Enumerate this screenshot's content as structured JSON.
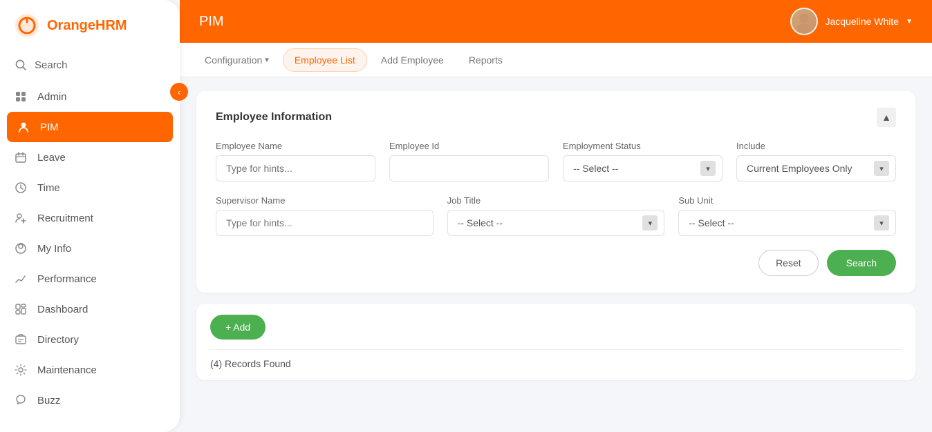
{
  "app": {
    "name": "OrangeHRM"
  },
  "header": {
    "title": "PIM",
    "user": {
      "name": "Jacqueline White",
      "chevron": "▼"
    }
  },
  "sidebar": {
    "toggle_icon": "‹",
    "search_label": "Search",
    "items": [
      {
        "id": "admin",
        "label": "Admin",
        "icon": "admin"
      },
      {
        "id": "pim",
        "label": "PIM",
        "icon": "pim",
        "active": true
      },
      {
        "id": "leave",
        "label": "Leave",
        "icon": "leave"
      },
      {
        "id": "time",
        "label": "Time",
        "icon": "time"
      },
      {
        "id": "recruitment",
        "label": "Recruitment",
        "icon": "recruitment"
      },
      {
        "id": "my-info",
        "label": "My Info",
        "icon": "my-info"
      },
      {
        "id": "performance",
        "label": "Performance",
        "icon": "performance"
      },
      {
        "id": "dashboard",
        "label": "Dashboard",
        "icon": "dashboard"
      },
      {
        "id": "directory",
        "label": "Directory",
        "icon": "directory"
      },
      {
        "id": "maintenance",
        "label": "Maintenance",
        "icon": "maintenance"
      },
      {
        "id": "buzz",
        "label": "Buzz",
        "icon": "buzz"
      }
    ]
  },
  "nav_tabs": [
    {
      "id": "configuration",
      "label": "Configuration",
      "has_dropdown": true,
      "active": false
    },
    {
      "id": "employee-list",
      "label": "Employee List",
      "has_dropdown": false,
      "active": true
    },
    {
      "id": "add-employee",
      "label": "Add Employee",
      "has_dropdown": false,
      "active": false
    },
    {
      "id": "reports",
      "label": "Reports",
      "has_dropdown": false,
      "active": false
    }
  ],
  "employee_info": {
    "section_title": "Employee Information",
    "fields": {
      "employee_name": {
        "label": "Employee Name",
        "placeholder": "Type for hints..."
      },
      "employee_id": {
        "label": "Employee Id",
        "placeholder": ""
      },
      "employment_status": {
        "label": "Employment Status",
        "placeholder": "-- Select --"
      },
      "include": {
        "label": "Include",
        "value": "Current Employees Only"
      },
      "supervisor_name": {
        "label": "Supervisor Name",
        "placeholder": "Type for hints..."
      },
      "job_title": {
        "label": "Job Title",
        "placeholder": "-- Select --"
      },
      "sub_unit": {
        "label": "Sub Unit",
        "placeholder": "-- Select --"
      }
    },
    "buttons": {
      "reset": "Reset",
      "search": "Search"
    }
  },
  "actions": {
    "add_button": "+ Add",
    "records_found": "(4) Records Found"
  }
}
